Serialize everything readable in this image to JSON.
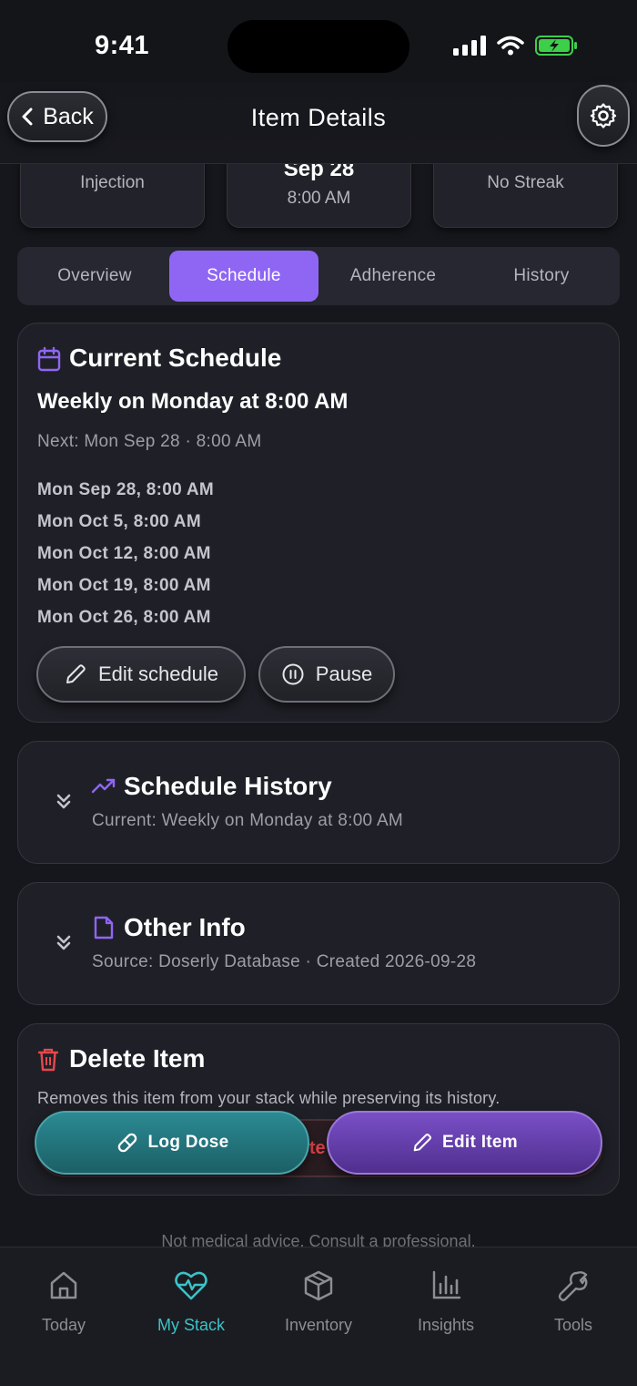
{
  "status": {
    "time": "9:41"
  },
  "header": {
    "back_label": "Back",
    "title": "Item Details"
  },
  "stats": [
    {
      "label": "Injection"
    },
    {
      "big": "Sep 28",
      "sub": "8:00 AM"
    },
    {
      "label": "No Streak"
    }
  ],
  "tabs": [
    {
      "label": "Overview",
      "active": false
    },
    {
      "label": "Schedule",
      "active": true
    },
    {
      "label": "Adherence",
      "active": false
    },
    {
      "label": "History",
      "active": false
    }
  ],
  "schedule": {
    "title": "Current Schedule",
    "rule": "Weekly on Monday at 8:00 AM",
    "next": "Next: Mon Sep 28 · 8:00 AM",
    "occurrences": [
      "Mon Sep 28, 8:00 AM",
      "Mon Oct 5, 8:00 AM",
      "Mon Oct 12, 8:00 AM",
      "Mon Oct 19, 8:00 AM",
      "Mon Oct 26, 8:00 AM"
    ],
    "edit_label": "Edit schedule",
    "pause_label": "Pause"
  },
  "history": {
    "title": "Schedule History",
    "subtitle": "Current: Weekly on Monday at 8:00 AM"
  },
  "other": {
    "title": "Other Info",
    "subtitle": "Source: Doserly Database · Created 2026-09-28"
  },
  "delete": {
    "title": "Delete Item",
    "description": "Removes this item from your stack while preserving its history.",
    "button_label": "Delete Item"
  },
  "actions": {
    "log_label": "Log Dose",
    "edit_label": "Edit Item"
  },
  "footer_note": "Not medical advice. Consult a professional.",
  "nav": [
    {
      "label": "Today",
      "icon": "home-icon"
    },
    {
      "label": "My Stack",
      "icon": "heart-pulse-icon",
      "active": true
    },
    {
      "label": "Inventory",
      "icon": "box-icon"
    },
    {
      "label": "Insights",
      "icon": "bar-chart-icon"
    },
    {
      "label": "Tools",
      "icon": "wrench-icon"
    }
  ],
  "colors": {
    "accent": "#8f66f4",
    "teal": "#3bc2c9",
    "danger": "#e5484d"
  }
}
